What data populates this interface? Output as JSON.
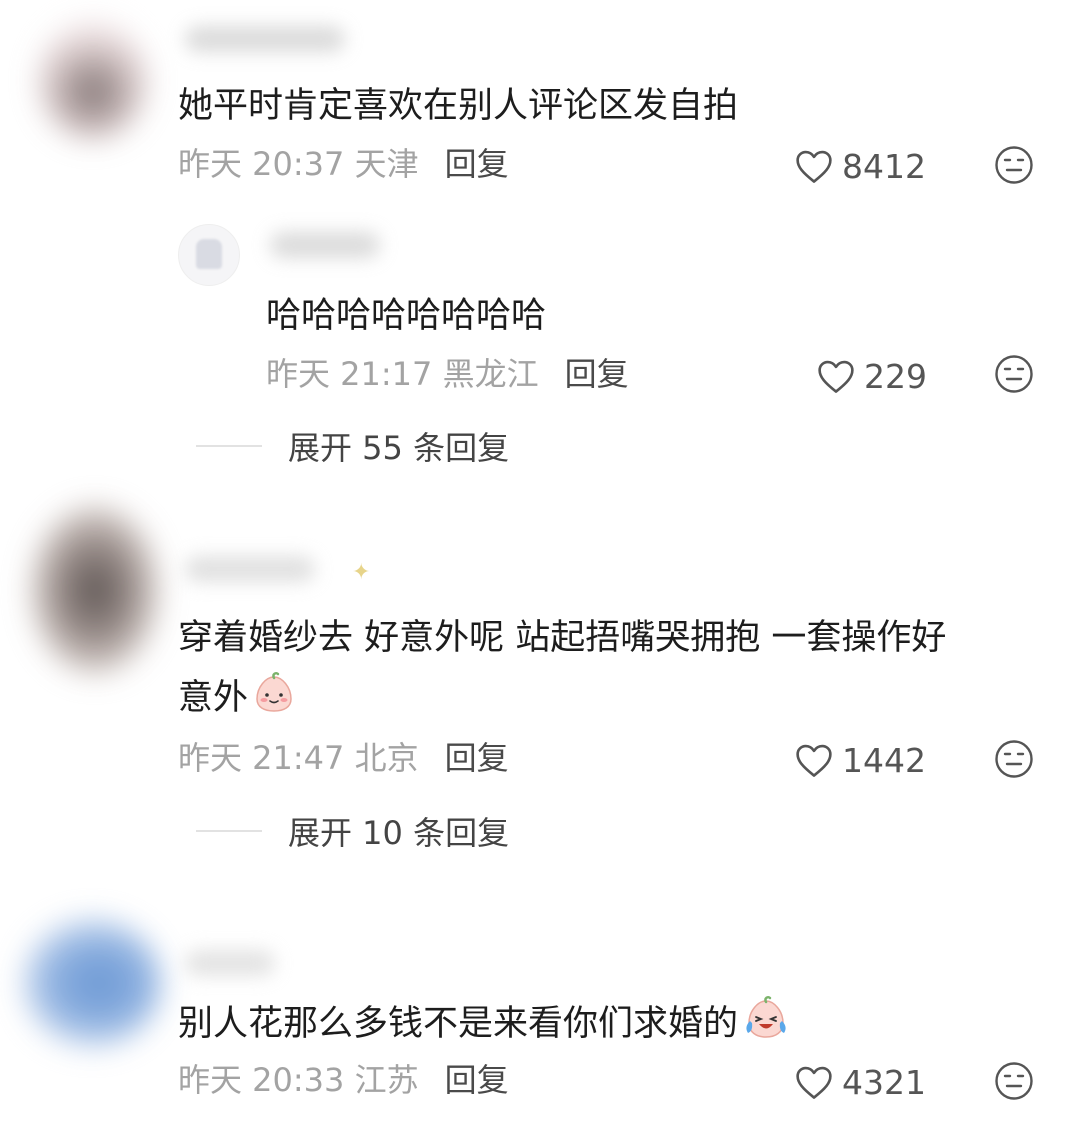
{
  "comments": [
    {
      "text": "她平时肯定喜欢在别人评论区发自拍",
      "meta": "昨天 20:37 天津",
      "reply": "回复",
      "likes": "8412",
      "subreply": {
        "text": "哈哈哈哈哈哈哈哈",
        "meta": "昨天 21:17 黑龙江",
        "reply": "回复",
        "likes": "229"
      },
      "expand": "展开 55 条回复"
    },
    {
      "text_line1": "穿着婚纱去 好意外呢 站起捂嘴哭拥抱 一套操作好",
      "text_line2": "意外",
      "emoji": "shy-face-emoji",
      "meta": "昨天 21:47 北京",
      "reply": "回复",
      "likes": "1442",
      "expand": "展开 10 条回复"
    },
    {
      "text": "别人花那么多钱不是来看你们求婚的",
      "emoji": "crying-laughing-emoji",
      "meta": "昨天 20:33 江苏",
      "reply": "回复",
      "likes": "4321"
    }
  ],
  "icons": {
    "like": "heart-outline-icon",
    "dislike": "neutral-face-icon"
  },
  "colors": {
    "text": "#1d1d1d",
    "meta": "#a3a3a3",
    "reply": "#4a4a4a",
    "divider": "#e2e2e2"
  }
}
